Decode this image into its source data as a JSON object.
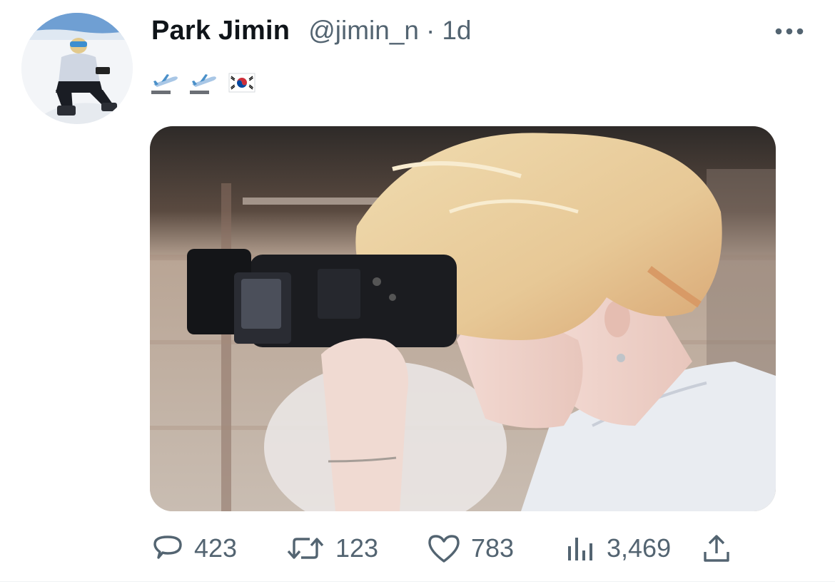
{
  "tweet": {
    "author": {
      "display_name": "Park Jimin",
      "handle": "@jimin_n",
      "separator": "·",
      "time": "1d"
    },
    "text_emojis": [
      "airplane-departure",
      "airplane-departure",
      "south-korea-flag"
    ],
    "actions": {
      "replies": "423",
      "retweets": "123",
      "likes": "783",
      "views": "3,469"
    }
  },
  "icons": {
    "more": "more-horizontal-icon",
    "reply": "speech-bubble-icon",
    "retweet": "retweet-arrows-icon",
    "like": "heart-icon",
    "views": "bar-chart-icon",
    "share": "share-upload-icon"
  },
  "colors": {
    "text_primary": "#0f1419",
    "text_secondary": "#536471",
    "background": "#ffffff"
  }
}
